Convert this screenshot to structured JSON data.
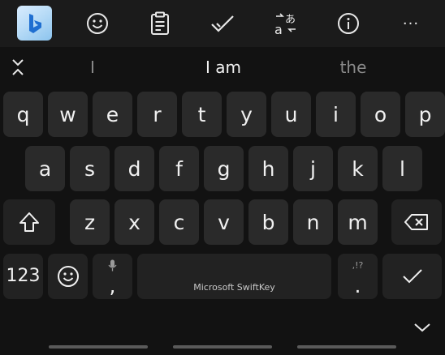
{
  "toolbar": {
    "items": [
      "bing-icon",
      "emoji-icon",
      "clipboard-icon",
      "check-icon",
      "translate-icon",
      "info-icon",
      "more-icon"
    ],
    "more_label": "···"
  },
  "suggestions": {
    "left": "I",
    "center": "I am",
    "right": "the"
  },
  "rows": {
    "row1": [
      "q",
      "w",
      "e",
      "r",
      "t",
      "y",
      "u",
      "i",
      "o",
      "p"
    ],
    "row2": [
      "a",
      "s",
      "d",
      "f",
      "g",
      "h",
      "j",
      "k",
      "l"
    ],
    "row3": [
      "z",
      "x",
      "c",
      "v",
      "b",
      "n",
      "m"
    ]
  },
  "keys": {
    "numbers": "123",
    "comma": ",",
    "period": ".",
    "period_sub": ",!?",
    "space_label": "Microsoft SwiftKey"
  },
  "colors": {
    "background": "#121212",
    "toolbar": "#1b1b1b",
    "key": "#2a2a2a",
    "bing_accent": "#1f6fd1"
  }
}
